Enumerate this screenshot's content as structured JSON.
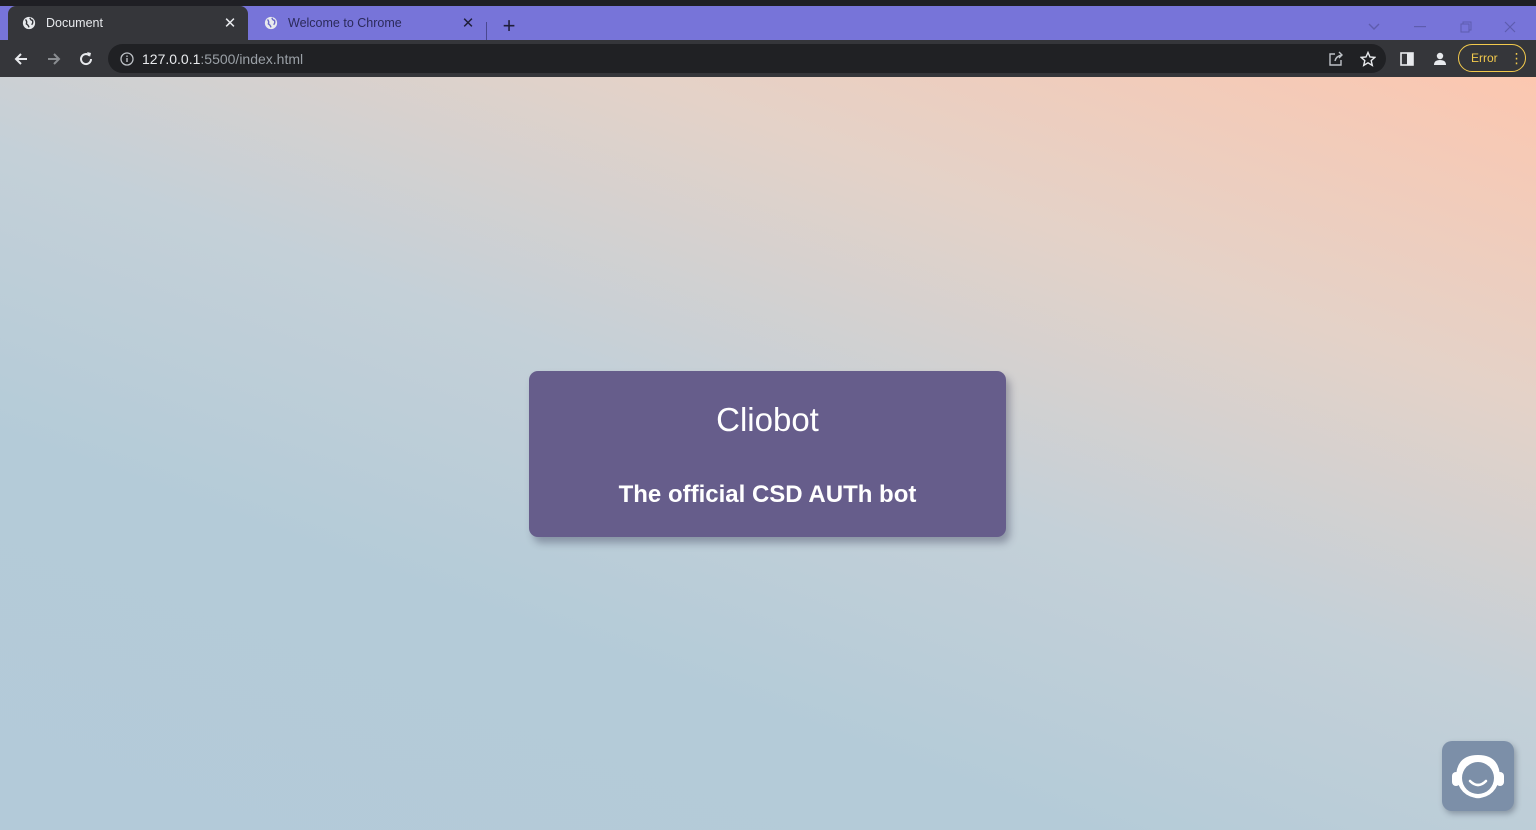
{
  "browser": {
    "tabs": [
      {
        "title": "Document",
        "icon": "globe-icon",
        "active": true
      },
      {
        "title": "Welcome to Chrome",
        "icon": "chrome-globe-icon",
        "active": false
      }
    ],
    "url_host": "127.0.0.1",
    "url_path": ":5500/index.html",
    "profile_status": "Error",
    "colors": {
      "tab_bar": "#7774d9",
      "toolbar": "#35363a",
      "omnibox": "#202124",
      "error_accent": "#f2c94c"
    }
  },
  "page": {
    "card": {
      "title": "Cliobot",
      "subtitle": "The official CSD AUTh bot"
    },
    "chat_button_icon": "support-agent-icon",
    "colors": {
      "card": "#665d8b",
      "chat_button": "#7c8fa8",
      "gradient_top": "#fcc7b0",
      "gradient_bottom": "#b3cad9"
    }
  }
}
